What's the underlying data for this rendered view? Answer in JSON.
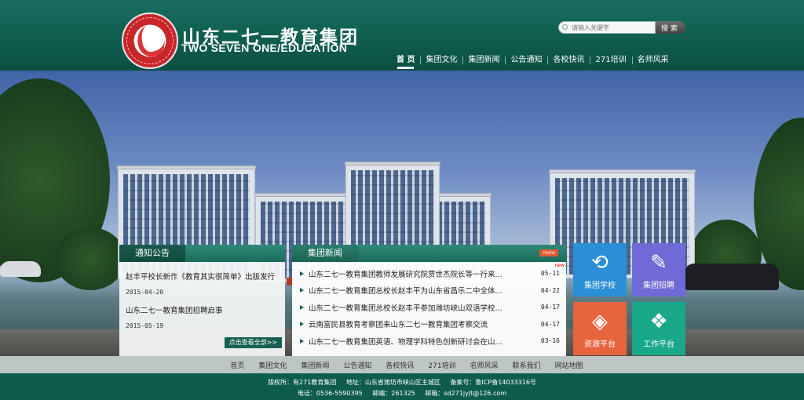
{
  "header": {
    "title_cn": "山东二七一教育集团",
    "title_en": "TWO SEVEN ONE/EDUCATION",
    "search": {
      "placeholder": "请输入关键字",
      "button": "搜索"
    }
  },
  "nav": {
    "items": [
      {
        "label": "首 页"
      },
      {
        "label": "集团文化"
      },
      {
        "label": "集团新闻"
      },
      {
        "label": "公告通知"
      },
      {
        "label": "各校快讯"
      },
      {
        "label": "271培训"
      },
      {
        "label": "名师风采"
      }
    ]
  },
  "notice": {
    "heading": "通知公告",
    "items": [
      {
        "title": "赵丰平校长新作《教育其实很简单》出版发行",
        "date": "2015-04-20"
      },
      {
        "title": "山东二七一教育集团招聘启事",
        "date": "2015-05-19"
      }
    ],
    "more_label": "点击查看全部>>"
  },
  "news": {
    "heading": "集团新闻",
    "more_label": "more",
    "items": [
      {
        "title": "山东二七一教育集团教师发展研究院贾世杰院长等一行来...",
        "date": "05-11",
        "badge": "new"
      },
      {
        "title": "山东二七一教育集团总校长赵丰平为山东省昌乐二中全体...",
        "date": "04-22"
      },
      {
        "title": "山东二七一教育集团总校长赵丰平参加潍坊峡山双语学校...",
        "date": "04-17"
      },
      {
        "title": "云南富民县教育考察团来山东二七一教育集团考察交流",
        "date": "04-17"
      },
      {
        "title": "山东二七一教育集团英语、物理学科特色创新研讨会在山...",
        "date": "03-16"
      }
    ]
  },
  "tiles": [
    {
      "label": "集团学校",
      "icon": "sync-icon",
      "glyph": "⟲",
      "color": "#2a8fd6"
    },
    {
      "label": "集团招聘",
      "icon": "document-edit-icon",
      "glyph": "✎",
      "color": "#6f6ad6"
    },
    {
      "label": "资源平台",
      "icon": "layers-icon",
      "glyph": "◈",
      "color": "#e8643c"
    },
    {
      "label": "工作平台",
      "icon": "diamond-grid-icon",
      "glyph": "❖",
      "color": "#1aa88a"
    }
  ],
  "footer": {
    "nav": [
      {
        "label": "首页"
      },
      {
        "label": "集团文化"
      },
      {
        "label": "集团新闻"
      },
      {
        "label": "公告通知"
      },
      {
        "label": "各校快讯"
      },
      {
        "label": "271培训"
      },
      {
        "label": "名师风采"
      },
      {
        "label": "联系我们"
      },
      {
        "label": "网站地图"
      }
    ],
    "line1": [
      "版权所：有271教育集团",
      "地址：山东省潍坊市峡山区主城区",
      "备案号：鲁ICP备14033316号"
    ],
    "line2": [
      "电话：0536-5590395",
      "邮编：261325",
      "邮箱：sd271jyjt@126.com"
    ]
  },
  "colors": {
    "header_green": "#0e5c4e",
    "footer_green": "#0d5c4e",
    "footer_nav_gray": "#bcc6c2"
  }
}
